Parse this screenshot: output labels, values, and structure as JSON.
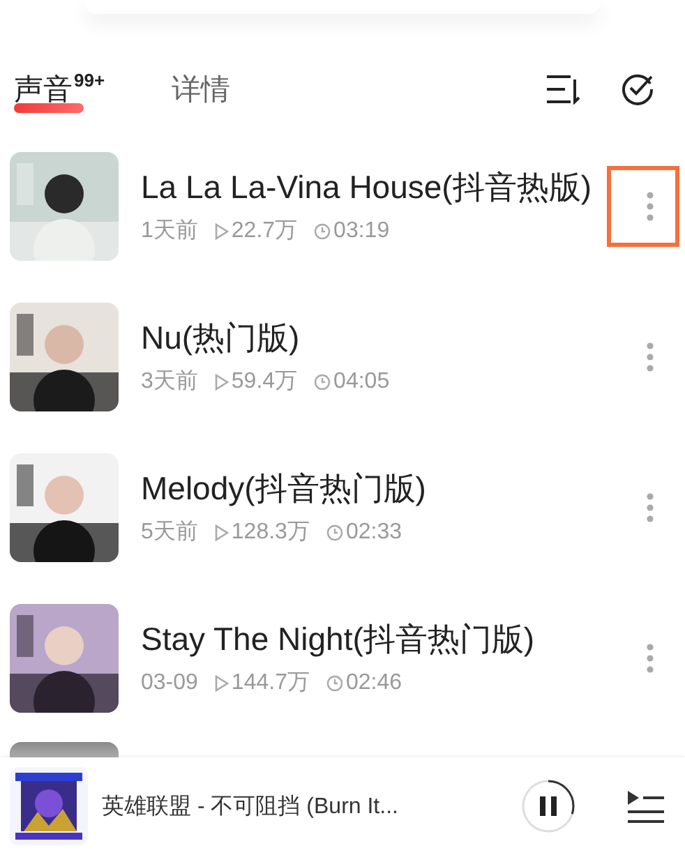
{
  "tabs": [
    {
      "label": "声音",
      "badge": "99+",
      "selected": true
    },
    {
      "label": "详情",
      "selected": false
    }
  ],
  "tracks": [
    {
      "title": "La La La-Vina House(抖音热版)",
      "date": "1天前",
      "plays": "22.7万",
      "duration": "03:19",
      "highlighted": true
    },
    {
      "title": "Nu(热门版)",
      "date": "3天前",
      "plays": "59.4万",
      "duration": "04:05",
      "highlighted": false
    },
    {
      "title": "Melody(抖音热门版)",
      "date": "5天前",
      "plays": "128.3万",
      "duration": "02:33",
      "highlighted": false
    },
    {
      "title": "Stay The Night(抖音热门版)",
      "date": "03-09",
      "plays": "144.7万",
      "duration": "02:46",
      "highlighted": false
    }
  ],
  "player": {
    "title": "英雄联盟 - 不可阻挡 (Burn It...",
    "playing": true,
    "level": 0.3
  }
}
